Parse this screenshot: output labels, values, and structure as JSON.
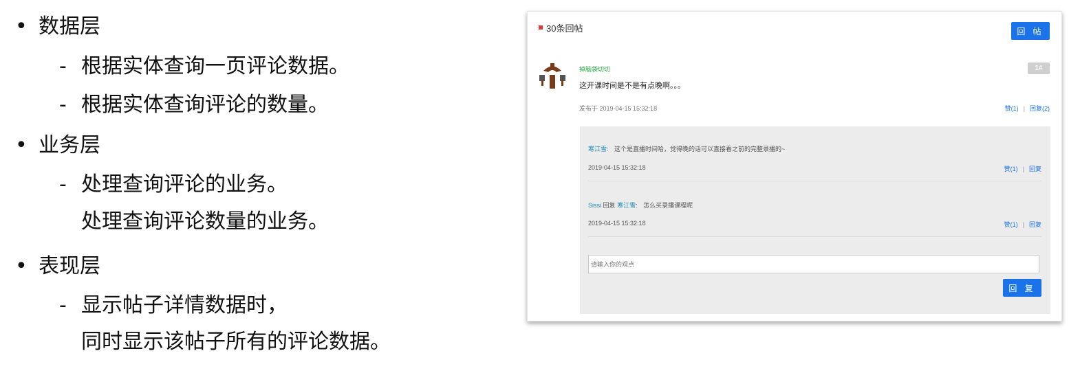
{
  "outline": {
    "bullet": "•",
    "dash": "-",
    "sections": [
      {
        "title": "数据层",
        "items": [
          "根据实体查询一页评论数据。",
          "根据实体查询评论的数量。"
        ]
      },
      {
        "title": "业务层",
        "items": [
          "处理查询评论的业务。",
          "处理查询评论数量的业务。"
        ]
      },
      {
        "title": "表现层",
        "items": [
          "显示帖子详情数据时，",
          "同时显示该帖子所有的评论数据。"
        ]
      }
    ]
  },
  "panel": {
    "header_title": "30条回帖",
    "post_button": "回 帖",
    "post": {
      "author": "掉脑袋切切",
      "floor": "1#",
      "content": "这开课时间是不是有点晚啊。。。",
      "time": "发布于 2019-04-15 15:32:18",
      "like": "赞(1)",
      "separator": "|",
      "reply": "回复(2)"
    },
    "replies": [
      {
        "user": "寒江雪",
        "colon": ":",
        "text": "这个是直播时间哈，觉得晚的话可以直接看之前的完整录播的~",
        "time": "2019-04-15 15:32:18",
        "like": "赞(1)",
        "reply": "回复"
      },
      {
        "user": "Sissi",
        "reply_word": "回复",
        "target": "寒江雪",
        "colon": ":",
        "text": "怎么买录播课程呢",
        "time": "2019-04-15 15:32:18",
        "like": "赞(1)",
        "reply": "回复"
      }
    ],
    "input_placeholder": "请输入你的观点",
    "reply_button": "回 复",
    "colors": {
      "accent": "#1a73e8",
      "author": "#28a745",
      "marker": "#e4393c",
      "username": "#1a8bb5"
    }
  }
}
